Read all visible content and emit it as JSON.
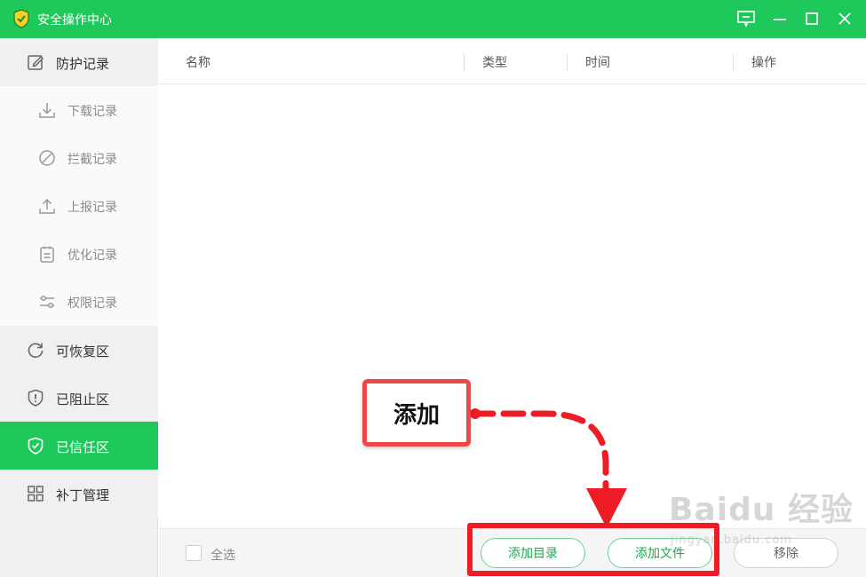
{
  "window": {
    "title": "安全操作中心",
    "accent": "#1ec85a"
  },
  "sidebar": {
    "items": [
      {
        "label": "防护记录",
        "icon": "edit-icon",
        "level": "top",
        "active": false
      },
      {
        "label": "下载记录",
        "icon": "download-icon",
        "level": "sub",
        "active": false
      },
      {
        "label": "拦截记录",
        "icon": "block-icon",
        "level": "sub",
        "active": false
      },
      {
        "label": "上报记录",
        "icon": "upload-icon",
        "level": "sub",
        "active": false
      },
      {
        "label": "优化记录",
        "icon": "document-icon",
        "level": "sub",
        "active": false
      },
      {
        "label": "权限记录",
        "icon": "sliders-icon",
        "level": "sub",
        "active": false
      },
      {
        "label": "可恢复区",
        "icon": "refresh-icon",
        "level": "top",
        "active": false
      },
      {
        "label": "已阻止区",
        "icon": "shield-alert-icon",
        "level": "top",
        "active": false
      },
      {
        "label": "已信任区",
        "icon": "shield-check-icon",
        "level": "top",
        "active": true
      },
      {
        "label": "补丁管理",
        "icon": "grid-icon",
        "level": "top",
        "active": false
      }
    ]
  },
  "table": {
    "columns": [
      "名称",
      "类型",
      "时间",
      "操作"
    ],
    "rows": []
  },
  "footer": {
    "select_all": "全选",
    "add_directory": "添加目录",
    "add_file": "添加文件",
    "remove": "移除"
  },
  "annotation": {
    "callout": "添加",
    "color": "#ee1c24"
  },
  "watermark": {
    "main": "Baidu 经验",
    "url": "jingyan.baidu.com"
  }
}
